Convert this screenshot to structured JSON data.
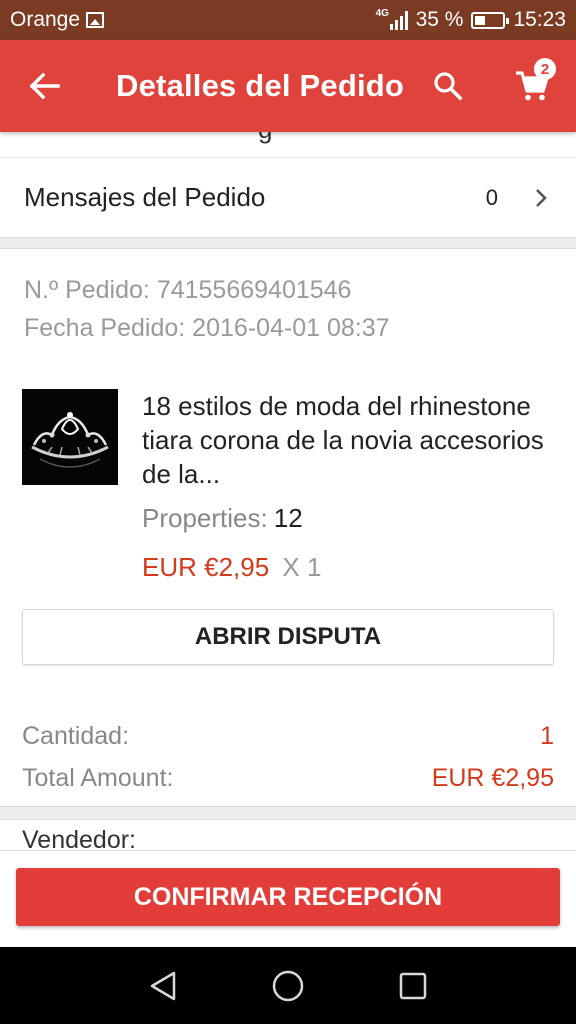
{
  "status_bar": {
    "carrier": "Orange",
    "network": "4G",
    "battery": "35 %",
    "battery_level": 0.35,
    "time": "15:23"
  },
  "app_bar": {
    "title": "Detalles del Pedido",
    "cart_count": "2",
    "icons": [
      "back-arrow-icon",
      "search-icon",
      "cart-icon"
    ]
  },
  "messages": {
    "label": "Mensajes del Pedido",
    "count": "0"
  },
  "order": {
    "number_line": "N.º Pedido: 74155669401546",
    "date_line": "Fecha Pedido: 2016-04-01 08:37"
  },
  "product": {
    "title": "18 estilos de moda del rhinestone tiara corona de la novia accesorios de la...",
    "properties_label": "Properties:",
    "properties_value": "12",
    "price": "EUR €2,95",
    "quantity": "X 1"
  },
  "dispute_button": "ABRIR DISPUTA",
  "totals": {
    "quantity_label": "Cantidad:",
    "quantity_value": "1",
    "amount_label": "Total Amount:",
    "amount_value": "EUR €2,95"
  },
  "seller_label": "Vendedor:",
  "confirm_button": "CONFIRMAR RECEPCIÓN",
  "colors": {
    "status_bar": "#7a3b22",
    "app_bar": "#e0433b",
    "price": "#d33a1c",
    "confirm": "#e33d3a"
  }
}
